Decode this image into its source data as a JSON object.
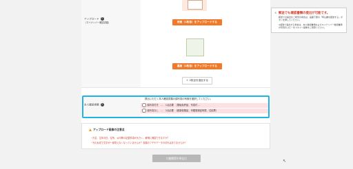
{
  "upload_section": {
    "label": "アップロード",
    "sub_label": "（マイナンバー確認書類）",
    "front_button": "表面（1枚目）をアップロードする",
    "back_button": "裏面（2枚目）をアップロードする",
    "add_button": "2枚目を追加する"
  },
  "identity_section": {
    "label": "本人確認書類",
    "description": "提出いただく本人確認書類の顔写真の有無を選択してください。",
    "options": [
      "顔写真付き　…　1点必要　（運転免許証、写真付…",
      "顔写真なし　…　2点必要　（健康保険証、印鑑登録証明書、住民票）"
    ]
  },
  "notice": {
    "title": "アップロード画像の注意点",
    "lines": [
      "・氏名、生年月日、住所、公印等の記載事項が大きく、鮮明に確認できますか？",
      "・光の反射で文字が一部見えなくなっていませんか？書類のフチやデータの切れはありませんか？"
    ]
  },
  "submit_label": "口座開設を申込む",
  "sidebox": {
    "close": "×",
    "title": "郵送でも確認書類の提出が可能です。",
    "line1": "郵送での提出をご希望の場合は、画面下部の「申込書を郵送する」ボタンを押してください。",
    "line2": "※郵送で提出する場合は、本人確認書類およびマイナンバー確認書類の写真のコピーをスキャン画像をご用意ください。"
  },
  "colors": {
    "accent": "#f07a2a",
    "highlight": "#1fb3e8",
    "warning_text": "#d0402f"
  }
}
